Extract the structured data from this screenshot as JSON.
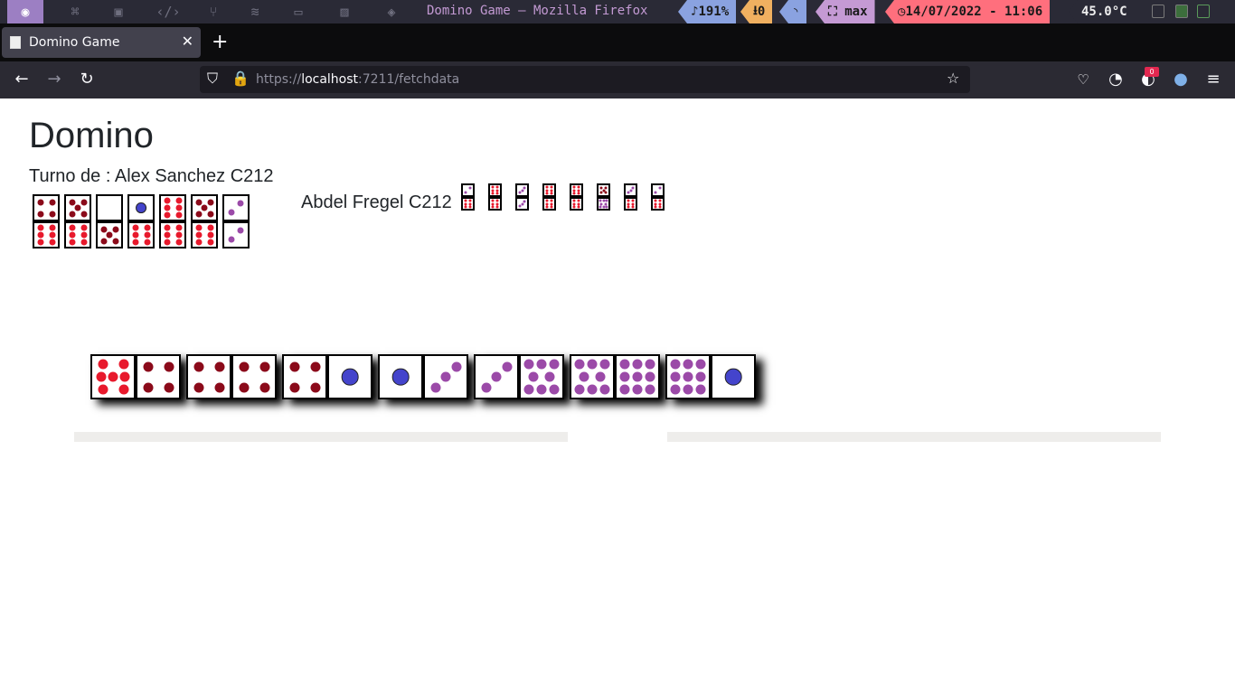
{
  "taskbar": {
    "window_title": "Domino Game — Mozilla Firefox",
    "volume": "191%",
    "downloads": "0",
    "layout": "max",
    "datetime": "14/07/2022 - 11:06",
    "temperature": "45.0°C"
  },
  "browser": {
    "tab_title": "Domino Game",
    "url_scheme": "https://",
    "url_host": "localhost",
    "url_rest": ":7211/fetchdata",
    "notification_count": "0"
  },
  "page": {
    "title": "Domino",
    "turn_text": "Turno de : Alex Sanchez C212",
    "opponent_name": "Abdel Fregel C212"
  },
  "pip_colors": {
    "0": "#ffffff",
    "1": "#4444cc",
    "2": "#9b4aa8",
    "3": "#9b4aa8",
    "4": "#8b0a1a",
    "5": "#8b0a1a",
    "6": "#e8192c",
    "7": "#e8192c",
    "8": "#9b4aa8",
    "9": "#9b4aa8"
  },
  "hand_tiles": [
    [
      4,
      6
    ],
    [
      5,
      6
    ],
    [
      0,
      5
    ],
    [
      1,
      6
    ],
    [
      6,
      6
    ],
    [
      5,
      6
    ],
    [
      2,
      2
    ]
  ],
  "opponent_tiles": [
    [
      2,
      6
    ],
    [
      6,
      6
    ],
    [
      3,
      3
    ],
    [
      6,
      6
    ],
    [
      6,
      6
    ],
    [
      5,
      8
    ],
    [
      3,
      6
    ],
    [
      2,
      6
    ]
  ],
  "board_tiles": [
    [
      7,
      4
    ],
    [
      4,
      4
    ],
    [
      4,
      1
    ],
    [
      1,
      3
    ],
    [
      3,
      8
    ],
    [
      8,
      9
    ],
    [
      9,
      1
    ]
  ]
}
